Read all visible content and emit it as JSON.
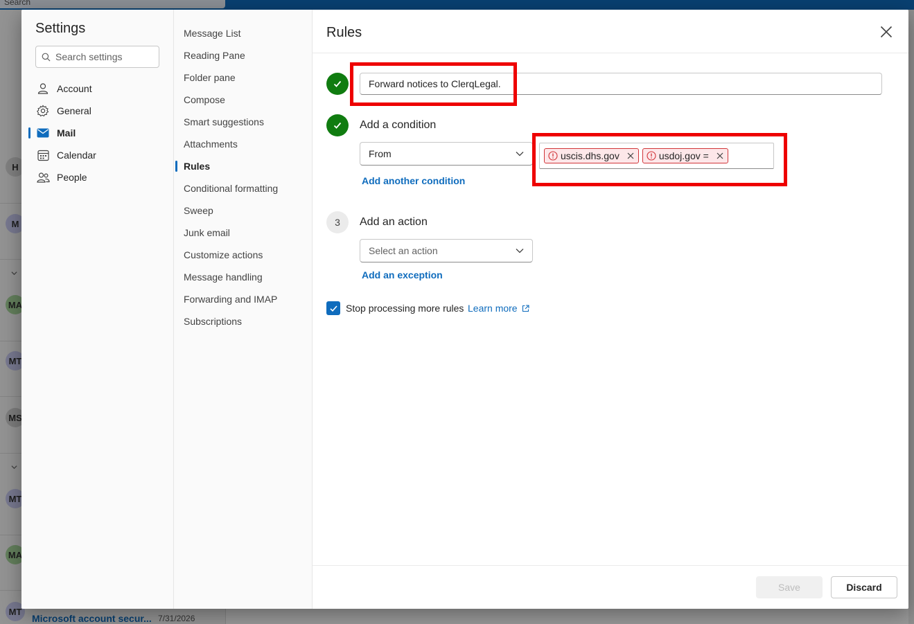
{
  "background": {
    "search_text": "Search",
    "avatars": [
      "H",
      "M",
      "MA",
      "MT",
      "MS",
      "MT",
      "MA",
      "MT"
    ],
    "last_row": {
      "title": "Microsoft account secur...",
      "date": "7/31/2026"
    }
  },
  "settings": {
    "title": "Settings",
    "search_placeholder": "Search settings",
    "nav": [
      {
        "label": "Account",
        "icon": "person-icon"
      },
      {
        "label": "General",
        "icon": "gear-icon"
      },
      {
        "label": "Mail",
        "icon": "mail-icon",
        "active": true
      },
      {
        "label": "Calendar",
        "icon": "calendar-icon"
      },
      {
        "label": "People",
        "icon": "people-icon"
      }
    ],
    "subnav": [
      "Message List",
      "Reading Pane",
      "Folder pane",
      "Compose",
      "Smart suggestions",
      "Attachments",
      "Rules",
      "Conditional formatting",
      "Sweep",
      "Junk email",
      "Customize actions",
      "Message handling",
      "Forwarding and IMAP",
      "Subscriptions"
    ],
    "subnav_active": "Rules"
  },
  "rules": {
    "title": "Rules",
    "rule_name": "Forward notices to ClerqLegal.",
    "condition": {
      "heading": "Add a condition",
      "selected": "From",
      "chips": [
        "uscis.dhs.gov",
        "usdoj.gov ="
      ],
      "add_link": "Add another condition"
    },
    "action": {
      "step_number": "3",
      "heading": "Add an action",
      "placeholder": "Select an action",
      "exception_link": "Add an exception"
    },
    "stop_processing": {
      "label": "Stop processing more rules",
      "checked": true,
      "learn_more": "Learn more"
    },
    "buttons": {
      "save": "Save",
      "discard": "Discard"
    }
  },
  "colors": {
    "accent": "#0f6cbd",
    "success": "#107c10",
    "chip_error_border": "#d13438",
    "chip_error_fill": "#fde7e9",
    "highlight": "#ee0000"
  }
}
